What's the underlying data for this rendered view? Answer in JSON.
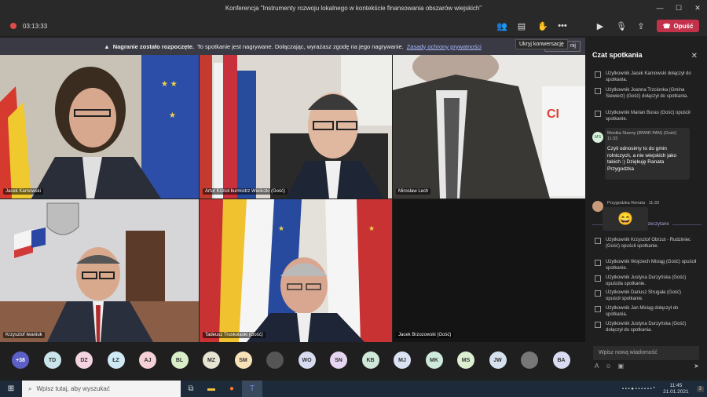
{
  "window": {
    "title": "Konferencja \"Instrumenty rozwoju lokalnego w kontekście finansowania obszarów wiejskich\""
  },
  "toolbar": {
    "timer": "03:13:33",
    "leave_label": "Opuść",
    "tooltip": "Ukryj konwersację"
  },
  "banner": {
    "bold": "Nagranie zostało rozpoczęte.",
    "text": "To spotkanie jest nagrywane. Dołączając, wyrażasz zgodę na jego nagrywanie.",
    "link": "Zasady ochrony prywatności",
    "dismiss": "nij"
  },
  "tiles": [
    {
      "name": "Jacek Karnowski"
    },
    {
      "name": "Artur Kozioł burmistrz Wieliczki (Gość)"
    },
    {
      "name": "Mirosław Lech"
    },
    {
      "name": "Krzysztof Iwaniuk"
    },
    {
      "name": "Tadeusz Truskolaski (Gość)"
    },
    {
      "name": "Jacek Brzozowski (Gość)"
    }
  ],
  "chat": {
    "title": "Czat spotkania",
    "events_top": [
      "Użytkownik Jacek Karnowski dołączył do spotkania.",
      "Użytkownik Joanna Trzcionka (Gmina Siewierz) (Gość) dołączył do spotkania.",
      "Użytkownik Marian Buras (Gość) opuścił spotkanie."
    ],
    "message1": {
      "initials": "MS",
      "author": "Monika Stanny (IRWIR PAN) (Gość)",
      "time": "11:33",
      "text": "Czyli odnosimy to do gmin rolniczych, a nie wiejskich jako takich :) Dziękuję Ranata Przygodzka"
    },
    "divider": "Ostatnio przeczytane",
    "message2": {
      "author": "Przygodzka Renata",
      "time": "11:33",
      "emoji": "😄"
    },
    "events_bottom": [
      "Użytkownik Krzysztof Obrzut - Rudziniec (Gość) opuścił spotkanie.",
      "Użytkownik Wojciech Misiąg (Gość) opuścił spotkanie.",
      "Użytkownik Justyna Durzyńska (Gość) opuściła spotkanie.",
      "Użytkownik Dariusz Strugała (Gość) opuścił spotkanie.",
      "Użytkownik Jan Misiąg dołączył do spotkania.",
      "Użytkownik Justyna Durzyńska (Gość) dołączył do spotkania."
    ],
    "compose_placeholder": "Wpisz nową wiadomość"
  },
  "participants": [
    "+38",
    "TD",
    "DZ",
    "ŁZ",
    "AJ",
    "BL",
    "MZ",
    "SM",
    "",
    "WO",
    "SN",
    "KB",
    "MJ",
    "MK",
    "MS",
    "JW",
    "",
    "BA"
  ],
  "participant_colors": [
    "#5b5fc7",
    "#c9e4ea",
    "#f4d4e0",
    "#cfe9f5",
    "#f5d0d6",
    "#d9edc9",
    "#e8e4d2",
    "#f7e2b8",
    "#555",
    "#d7dcf0",
    "#e6d6f1",
    "#cfe8d8",
    "#dbe2f4",
    "#cdeadc",
    "#dcefd0",
    "#d6e1ee",
    "#777",
    "#d9dbf2"
  ],
  "taskbar": {
    "search_placeholder": "Wpisz tutaj, aby wyszukać",
    "time": "11:45",
    "date": "21.01.2021",
    "badge": "3"
  }
}
